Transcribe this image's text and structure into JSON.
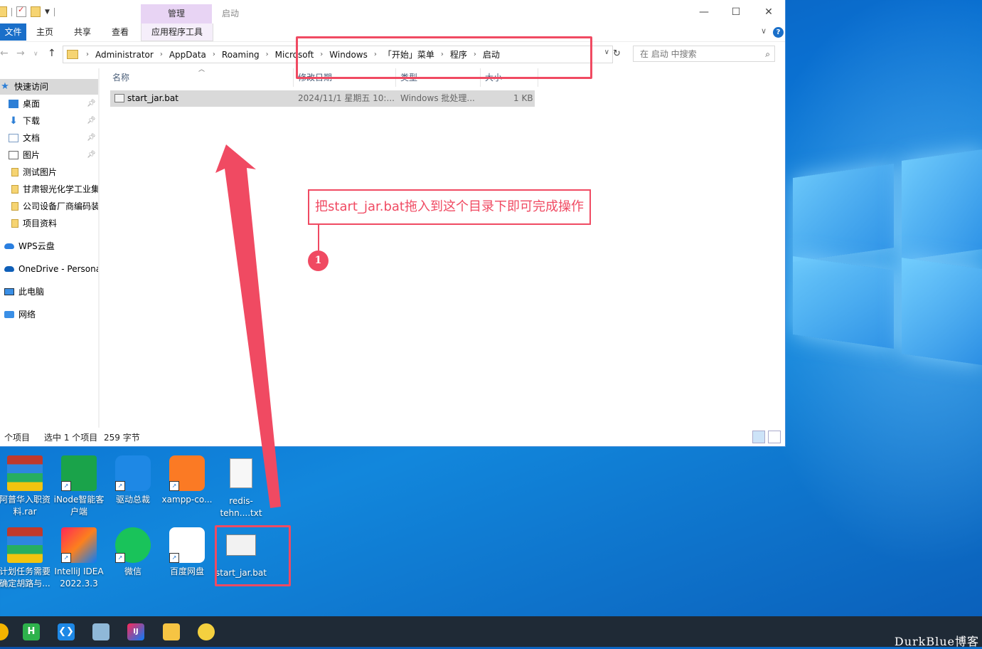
{
  "window": {
    "manage_tab": "管理",
    "title": "启动",
    "minimize": "—",
    "maximize": "☐",
    "close": "✕"
  },
  "ribbon": {
    "tabs": [
      "文件",
      "主页",
      "共享",
      "查看",
      "应用程序工具"
    ],
    "help": "?"
  },
  "address_bar": {
    "crumbs": [
      "Administrator",
      "AppData",
      "Roaming",
      "Microsoft",
      "Windows",
      "「开始」菜单",
      "程序",
      "启动"
    ],
    "search_placeholder": "在 启动 中搜索"
  },
  "sidebar": {
    "items": [
      {
        "label": "快速访问",
        "icon": "star-icon"
      },
      {
        "label": "桌面",
        "icon": "desktop-icon",
        "pinned": true
      },
      {
        "label": "下载",
        "icon": "download-icon",
        "pinned": true
      },
      {
        "label": "文档",
        "icon": "document-icon",
        "pinned": true
      },
      {
        "label": "图片",
        "icon": "picture-icon",
        "pinned": true
      },
      {
        "label": "测试图片",
        "icon": "folder-icon"
      },
      {
        "label": "甘肃银光化学工业集",
        "icon": "folder-icon"
      },
      {
        "label": "公司设备厂商编码装",
        "icon": "folder-icon"
      },
      {
        "label": "项目资料",
        "icon": "folder-icon"
      },
      {
        "label": "WPS云盘",
        "icon": "cloud-icon"
      },
      {
        "label": "OneDrive - Persona",
        "icon": "onedrive-icon"
      },
      {
        "label": "此电脑",
        "icon": "computer-icon"
      },
      {
        "label": "网络",
        "icon": "network-icon"
      }
    ]
  },
  "file_list": {
    "columns": [
      "名称",
      "修改日期",
      "类型",
      "大小"
    ],
    "rows": [
      {
        "name": "start_jar.bat",
        "date": "2024/11/1 星期五 10:...",
        "type": "Windows 批处理...",
        "size": "1 KB"
      }
    ]
  },
  "status_bar": {
    "count": "个项目",
    "selected": "选中 1 个项目",
    "size": "259 字节"
  },
  "annotation": {
    "callout_text": "把start_jar.bat拖入到这个目录下即可完成操作",
    "badge": "1",
    "color": "#f04a62"
  },
  "desktop": {
    "icons": [
      {
        "label": "阿普华入职资料.rar",
        "icon": "winrar-icon"
      },
      {
        "label": "iNode智能客户端",
        "icon": "inode-icon"
      },
      {
        "label": "驱动总裁",
        "icon": "driver-icon"
      },
      {
        "label": "xampp-co...",
        "icon": "xampp-icon"
      },
      {
        "label": "redis-tehn....txt",
        "icon": "text-file-icon"
      },
      {
        "label": "计划任务需要确定胡路与...",
        "icon": "winrar-icon"
      },
      {
        "label": "IntelliJ IDEA 2022.3.3",
        "icon": "intellij-icon"
      },
      {
        "label": "微信",
        "icon": "wechat-icon"
      },
      {
        "label": "百度网盘",
        "icon": "baidu-netdisk-icon"
      },
      {
        "label": "start_jar.bat",
        "icon": "batch-file-icon"
      }
    ]
  },
  "taskbar": {
    "apps": [
      "chrome-icon",
      "hbuilder-icon",
      "vscode-icon",
      "notepad-icon",
      "intellij-icon",
      "explorer-icon",
      "pet-icon"
    ],
    "hbuilder_letter": "H",
    "intellij_letter": "IJ"
  },
  "watermark": "DurkBlue博客"
}
